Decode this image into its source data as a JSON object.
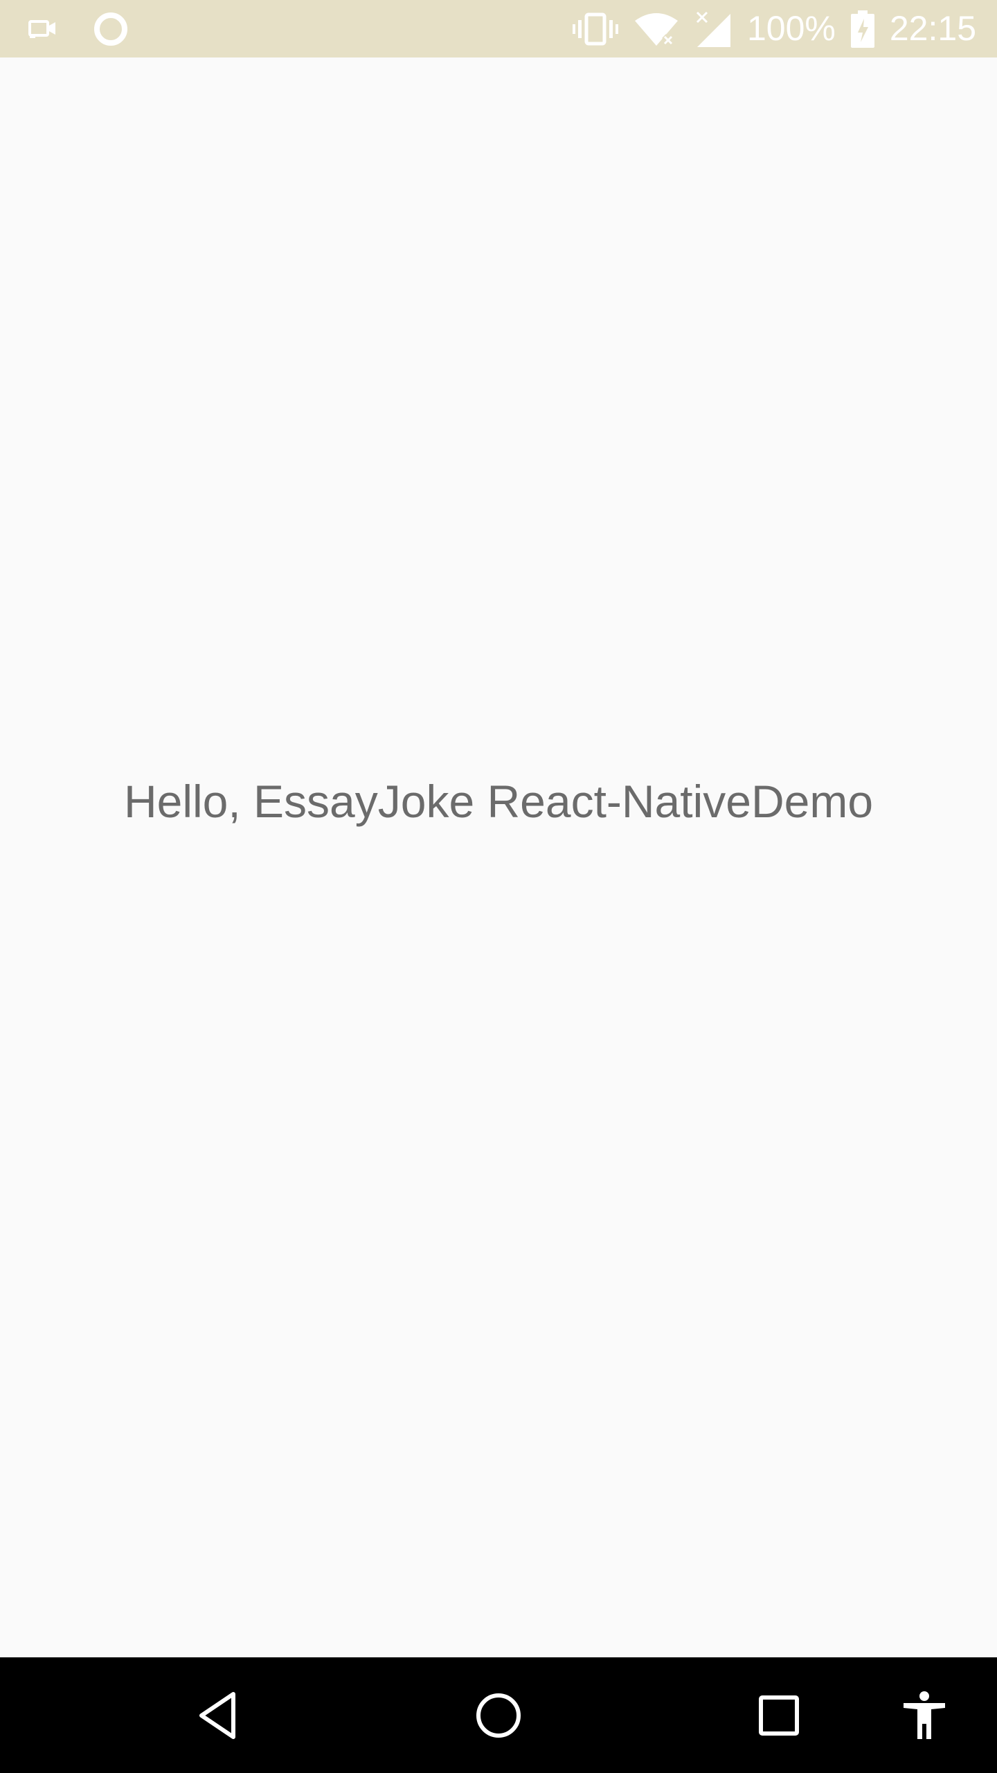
{
  "status_bar": {
    "background": "#e6e0c6",
    "left_icons": [
      "video-call-icon",
      "circle-notification-icon"
    ],
    "right_icons": [
      "vibrate-icon",
      "wifi-icon",
      "signal-icon",
      "battery-icon"
    ],
    "battery_percent": "100%",
    "time": "22:15"
  },
  "main": {
    "greeting": "Hello, EssayJoke React-NativeDemo",
    "text_color": "#6b6b6b",
    "background": "#fafafa"
  },
  "nav_bar": {
    "background": "#000000",
    "buttons": [
      "back-icon",
      "home-icon",
      "recents-icon",
      "accessibility-icon"
    ]
  }
}
